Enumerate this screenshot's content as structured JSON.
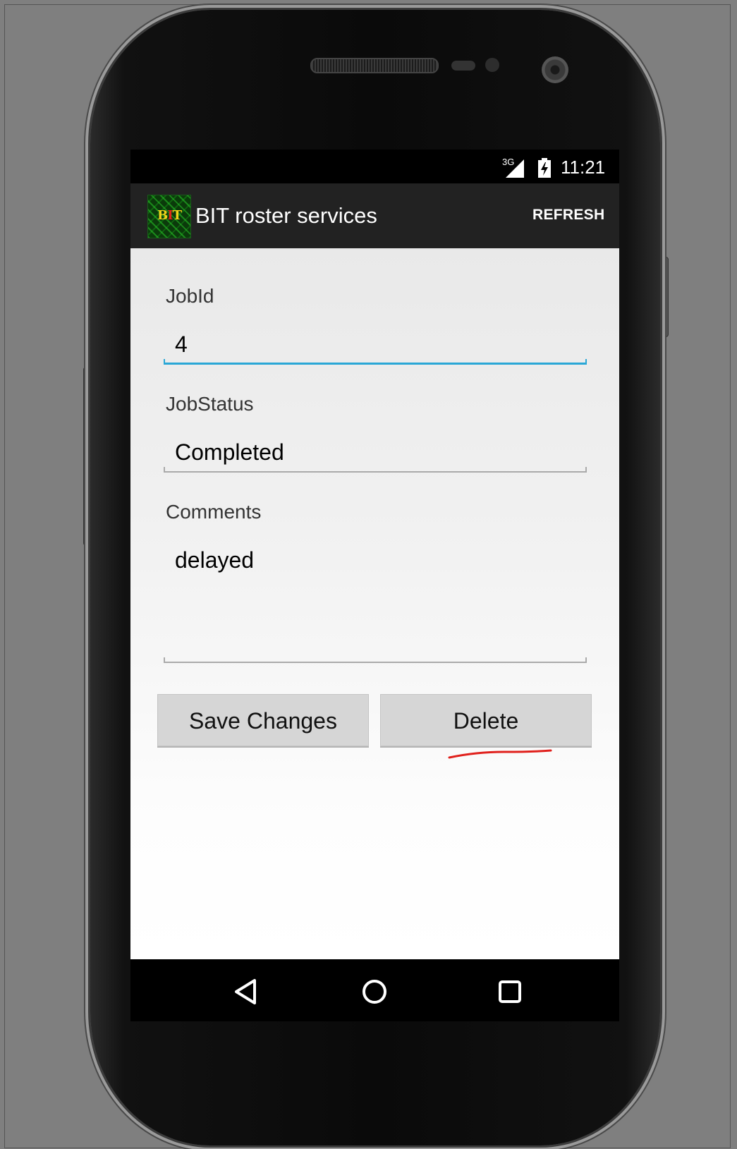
{
  "status_bar": {
    "network": "3G",
    "time": "11:21",
    "icons": [
      "signal-icon",
      "battery-icon"
    ]
  },
  "action_bar": {
    "logo_text_left": "B",
    "logo_text_mid": "I",
    "logo_text_right": "T",
    "title": "BIT roster services",
    "refresh_label": "REFRESH"
  },
  "form": {
    "job_id": {
      "label": "JobId",
      "value": "4"
    },
    "job_status": {
      "label": "JobStatus",
      "value": "Completed"
    },
    "comments": {
      "label": "Comments",
      "value": "delayed"
    }
  },
  "buttons": {
    "save_label": "Save Changes",
    "delete_label": "Delete"
  },
  "nav_bar": {
    "icons": [
      "back-icon",
      "home-icon",
      "recent-apps-icon"
    ]
  },
  "colors": {
    "action_bar": "#222222",
    "focus_accent": "#2aa7d6",
    "annotation": "#e0201c",
    "button_bg": "#d6d6d6"
  }
}
